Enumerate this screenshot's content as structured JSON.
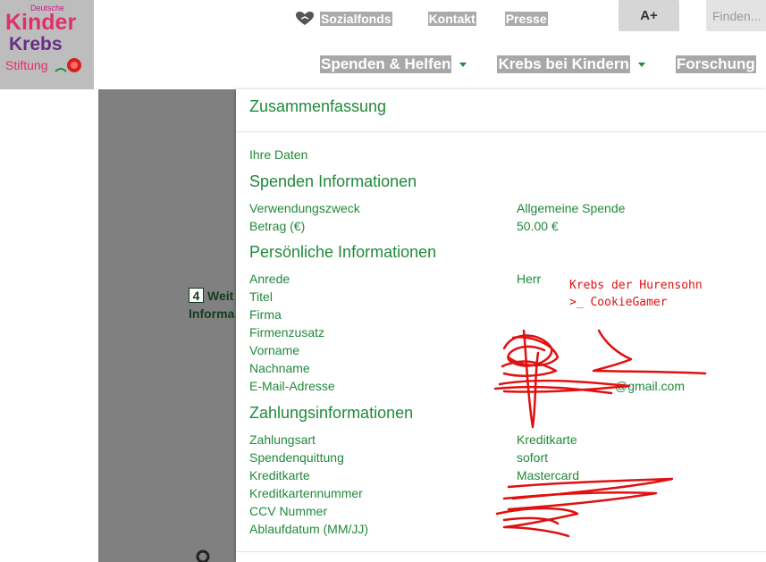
{
  "logo": {
    "line1": "Deutsche",
    "line2": "Kinder",
    "line3": "Krebs",
    "line4": "Stiftung"
  },
  "topnav": {
    "items": [
      "Sozialfonds",
      "Kontakt",
      "Presse"
    ],
    "font_size_label": "A+",
    "search_placeholder": "Finden..."
  },
  "mainnav": {
    "items": [
      "Spenden & Helfen",
      "Krebs bei Kindern",
      "Forschung"
    ]
  },
  "background_page": {
    "step_number": "4",
    "step_label_line1": "Weit",
    "step_label_line2": "Informa"
  },
  "modal": {
    "title": "Zusammenfassung",
    "your_data": "Ihre Daten",
    "sections": [
      {
        "heading": "Spenden Informationen",
        "rows": [
          {
            "label": "Verwendungszweck",
            "value": "Allgemeine Spende"
          },
          {
            "label": "Betrag (€)",
            "value": "50.00 €"
          }
        ]
      },
      {
        "heading": "Persönliche Informationen",
        "rows": [
          {
            "label": "Anrede",
            "value": "Herr"
          },
          {
            "label": "Titel",
            "value": ""
          },
          {
            "label": "Firma",
            "value": ""
          },
          {
            "label": "Firmenzusatz",
            "value": ""
          },
          {
            "label": "Vorname",
            "value": ""
          },
          {
            "label": "Nachname",
            "value": ""
          },
          {
            "label": "E-Mail-Adresse",
            "value": "@gmail.com"
          }
        ]
      },
      {
        "heading": "Zahlungsinformationen",
        "rows": [
          {
            "label": "Zahlungsart",
            "value": "Kreditkarte"
          },
          {
            "label": "Spendenquittung",
            "value": "sofort"
          },
          {
            "label": "Kreditkarte",
            "value": "Mastercard"
          },
          {
            "label": "Kreditkartennummer",
            "value": ""
          },
          {
            "label": "CCV Nummer",
            "value": ""
          },
          {
            "label": "Ablaufdatum (MM/JJ)",
            "value": ""
          }
        ]
      }
    ]
  },
  "annotation": {
    "line1": "Krebs der Hurensohn",
    "line2": ">_ CookieGamer"
  },
  "colors": {
    "green": "#1f8a3a",
    "scribble_red": "#e01010",
    "backdrop": "#808080"
  }
}
